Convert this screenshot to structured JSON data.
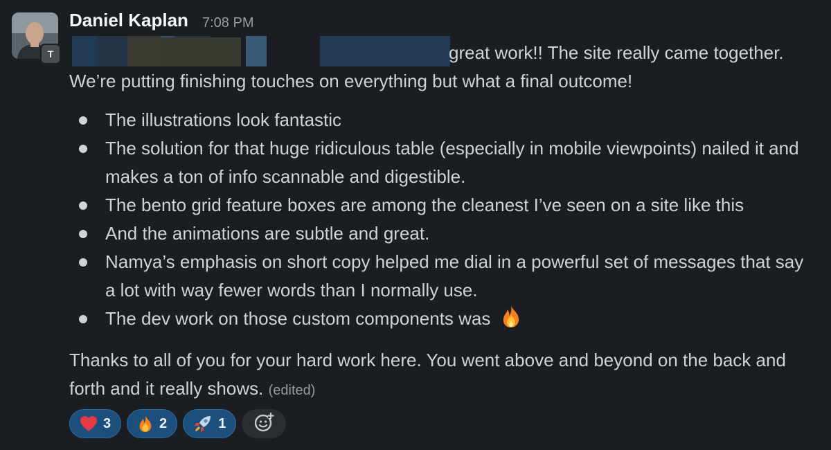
{
  "message": {
    "author": "Daniel Kaplan",
    "timestamp": "7:08 PM",
    "avatar_badge": "T",
    "line1": "great work!! The site really came together.",
    "line2": "We’re putting finishing touches on everything but what a final outcome!",
    "bullets": [
      "The illustrations look fantastic",
      "The solution for that huge ridiculous table (especially in mobile viewpoints) nailed it and makes a ton of info scannable and digestible.",
      "The bento grid feature boxes are among the cleanest I’ve seen on a site like this",
      "And the animations are subtle and great.",
      "Namya’s emphasis on short copy helped me dial in a powerful set of messages that say a lot with way fewer words than I normally use.",
      "The dev work on those custom components was"
    ],
    "closing": "Thanks to all of you for your hard work here. You went above and beyond on the back and forth and it really shows.",
    "edited_label": "(edited)"
  },
  "reactions": [
    {
      "icon": "heart-icon",
      "count": "3"
    },
    {
      "icon": "fire-icon",
      "count": "2"
    },
    {
      "icon": "rocket-icon",
      "count": "1"
    }
  ],
  "colors": {
    "background": "#1a1d21",
    "text": "#d1d2d3",
    "author": "#f8f8f8",
    "muted": "#9a9b9d",
    "reaction_bg": "#1d4f7c",
    "reaction_border": "#2c6aa3"
  }
}
